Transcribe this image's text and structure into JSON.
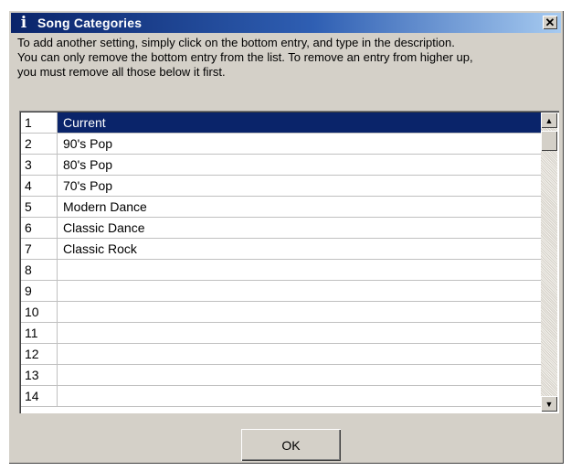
{
  "window": {
    "title": "Song Categories",
    "title_icon": "info-icon",
    "close_glyph": "✕"
  },
  "description": {
    "line1": "To add another setting, simply click on the bottom entry, and type in the description.",
    "line2": "You can only remove the bottom entry from the list. To remove an entry from higher up,",
    "line3": "you must remove all those below it first."
  },
  "list": {
    "selected_index": 0,
    "rows": [
      {
        "num": "1",
        "name": "Current"
      },
      {
        "num": "2",
        "name": "90's Pop"
      },
      {
        "num": "3",
        "name": "80's Pop"
      },
      {
        "num": "4",
        "name": "70's Pop"
      },
      {
        "num": "5",
        "name": "Modern Dance"
      },
      {
        "num": "6",
        "name": "Classic Dance"
      },
      {
        "num": "7",
        "name": "Classic Rock"
      },
      {
        "num": "8",
        "name": ""
      },
      {
        "num": "9",
        "name": ""
      },
      {
        "num": "10",
        "name": ""
      },
      {
        "num": "11",
        "name": ""
      },
      {
        "num": "12",
        "name": ""
      },
      {
        "num": "13",
        "name": ""
      },
      {
        "num": "14",
        "name": ""
      }
    ]
  },
  "buttons": {
    "ok_label": "OK"
  },
  "colors": {
    "titlebar_start": "#0a246a",
    "titlebar_end": "#a6caf0",
    "selection": "#0a246a",
    "dialog_face": "#d4d0c8"
  }
}
